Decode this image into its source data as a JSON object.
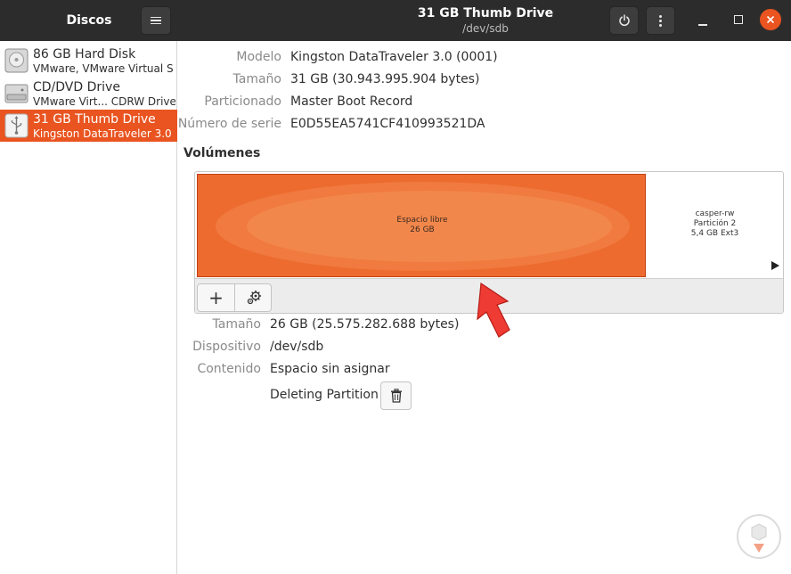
{
  "app": {
    "title": "Discos",
    "window_title": "31 GB Thumb Drive",
    "window_subtitle": "/dev/sdb",
    "accent_color": "#e95420"
  },
  "sidebar": {
    "items": [
      {
        "name": "86 GB Hard Disk",
        "description": "VMware, VMware Virtual S",
        "icon": "hard-disk-icon",
        "selected": false
      },
      {
        "name": "CD/DVD Drive",
        "description": "VMware Virt... CDRW Drive",
        "icon": "optical-drive-icon",
        "selected": false
      },
      {
        "name": "31 GB Thumb Drive",
        "description": "Kingston DataTraveler 3.0",
        "icon": "usb-drive-icon",
        "selected": true
      }
    ]
  },
  "disk_info": {
    "model_label": "Modelo",
    "model_value": "Kingston DataTraveler 3.0 (0001)",
    "size_label": "Tamaño",
    "size_value": "31 GB (30.943.995.904 bytes)",
    "partitioning_label": "Particionado",
    "partitioning_value": "Master Boot Record",
    "serial_label": "Número de serie",
    "serial_value": "E0D55EA5741CF410993521DA"
  },
  "volumes": {
    "heading": "Volúmenes",
    "free_space": {
      "line1": "Espacio libre",
      "line2": "26 GB"
    },
    "partition": {
      "line1": "casper-rw",
      "line2": "Partición 2",
      "line3": "5,4 GB Ext3"
    }
  },
  "toolbar": {
    "add_label": "+",
    "settings_icon": "gears-icon"
  },
  "selection_details": {
    "size_label": "Tamaño",
    "size_value": "26 GB (25.575.282.688 bytes)",
    "device_label": "Dispositivo",
    "device_value": "/dev/sdb",
    "contents_label": "Contenido",
    "contents_value": "Espacio sin asignar",
    "deleting_label": "Deleting Partition"
  }
}
